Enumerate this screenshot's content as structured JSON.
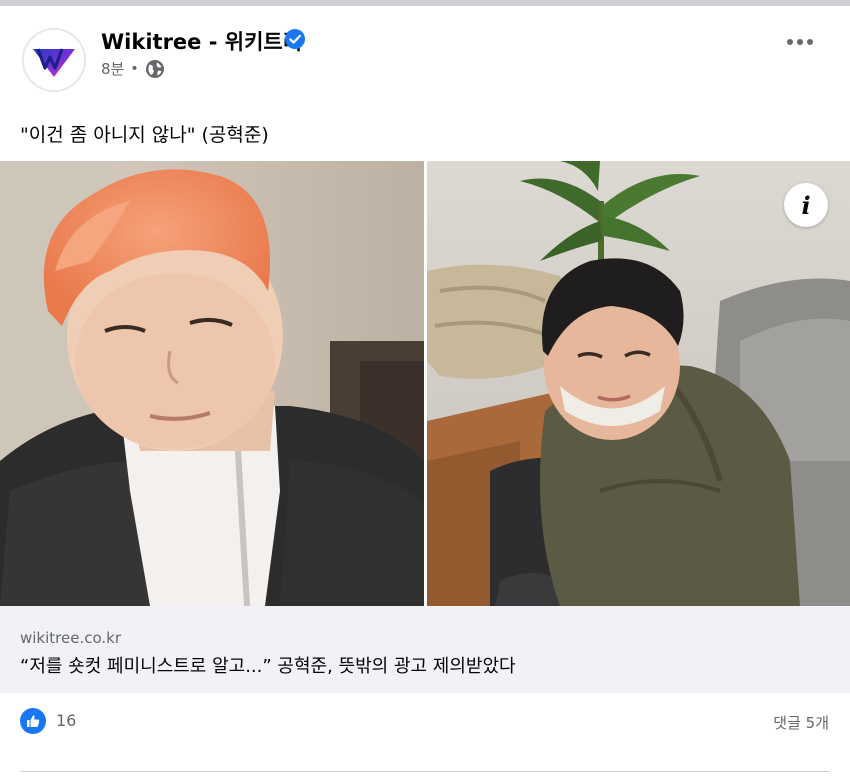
{
  "post": {
    "page_name": "Wikitree - 위키트리",
    "timestamp": "8분",
    "separator": "•",
    "caption": "\"이건 좀 아니지 않나\" (공혁준)",
    "logo_icon": "wikitree-logo-icon",
    "verified_icon": "verified-badge-icon",
    "audience_icon": "globe-icon",
    "more_icon": "more-options-icon"
  },
  "photo": {
    "info_glyph": "i",
    "info_icon": "info-icon"
  },
  "link_preview": {
    "domain": "wikitree.co.kr",
    "title": "“저를 숏컷 페미니스트로 알고...” 공혁준, 뜻밖의 광고 제의받았다"
  },
  "reactions": {
    "like_icon": "like-thumb-icon",
    "like_count": "16",
    "comments": "댓글 5개"
  },
  "colors": {
    "facebook_blue": "#1877f2",
    "secondary_text": "#65676b",
    "link_box_bg": "#f0f2f5",
    "hair_orange": "#f08a5d"
  }
}
